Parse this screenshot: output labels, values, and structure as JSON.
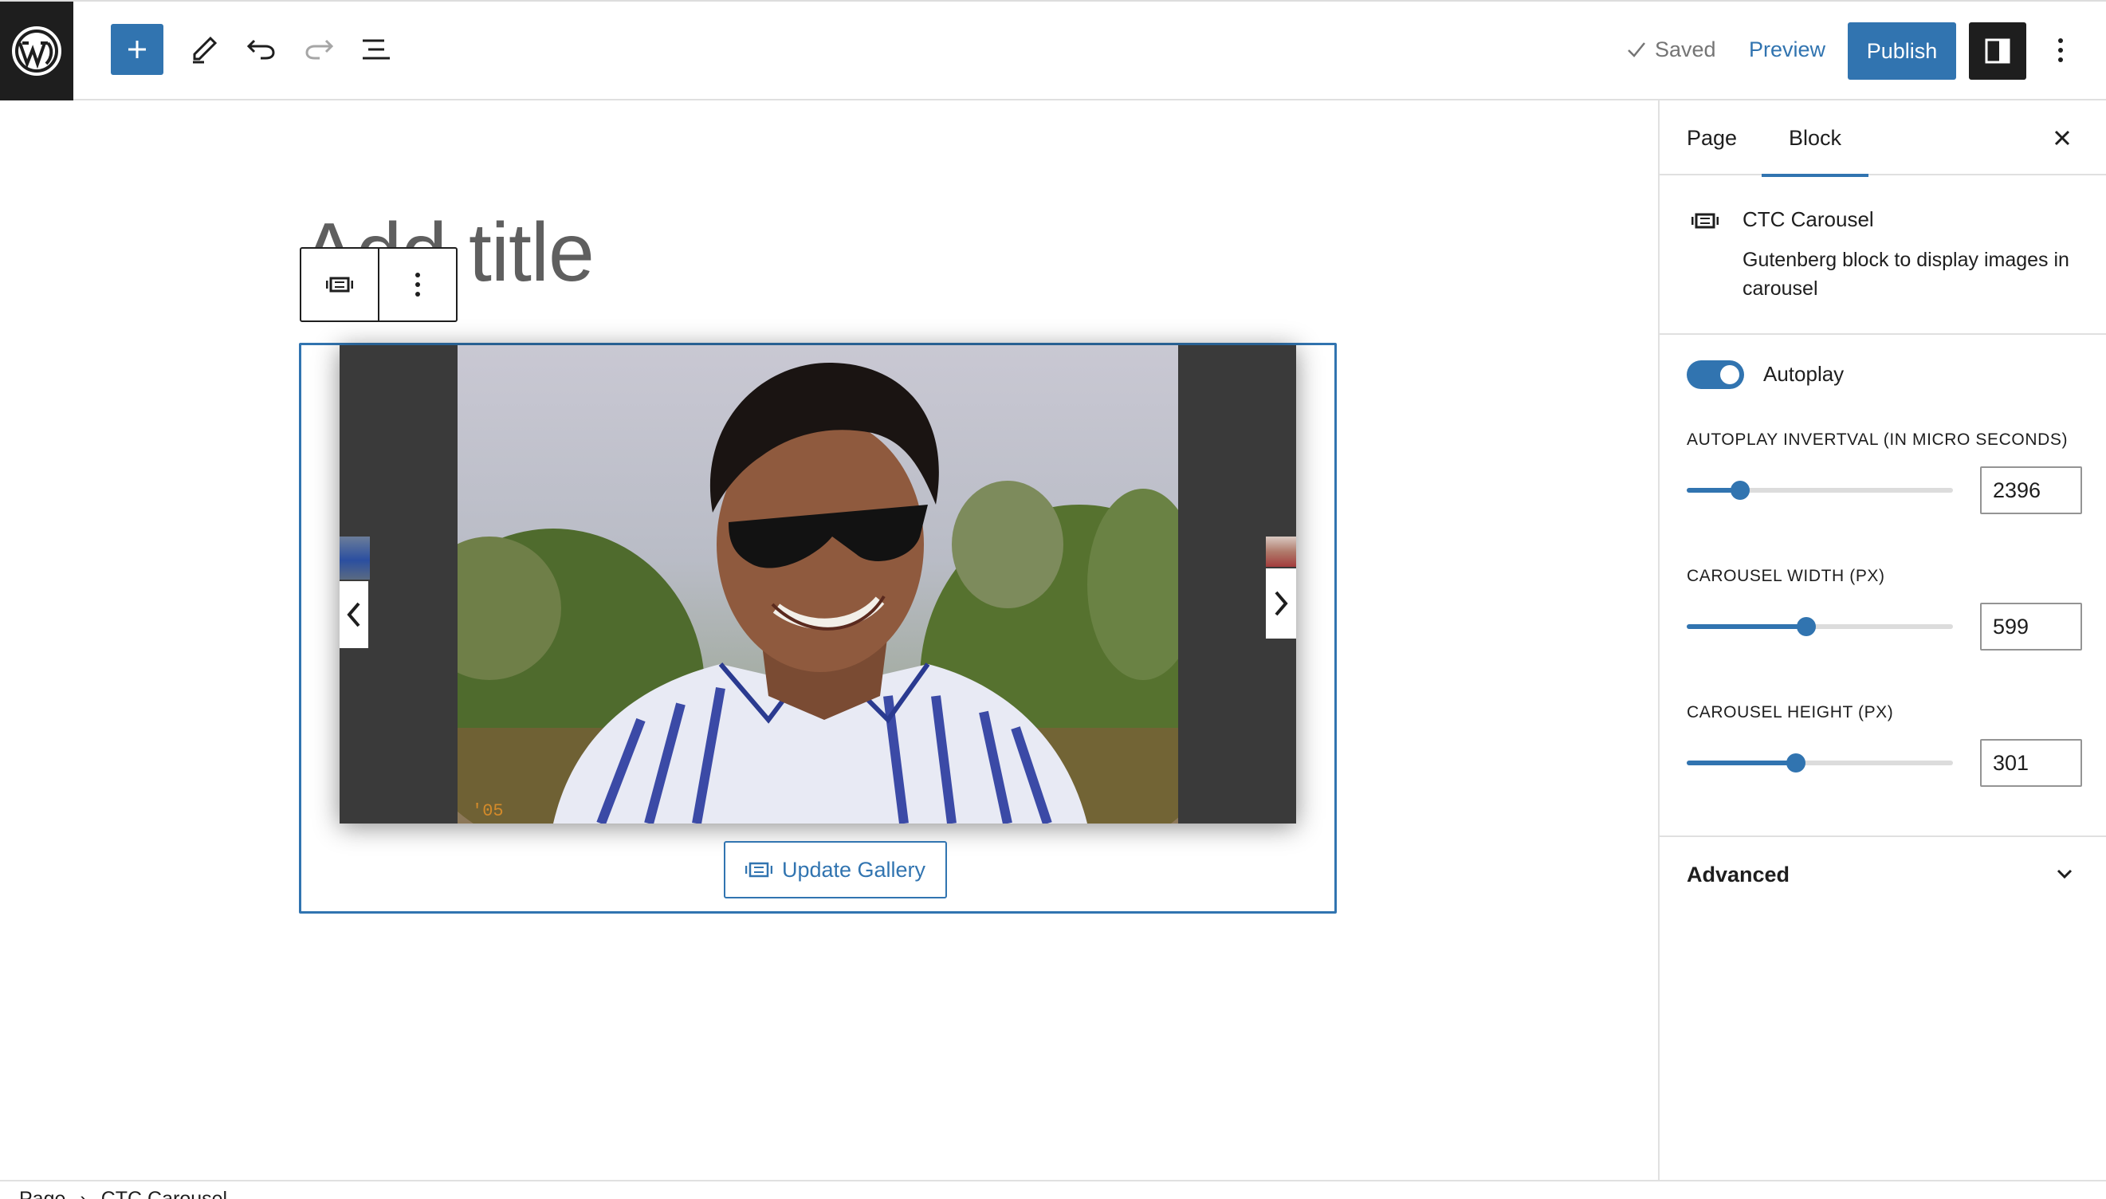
{
  "header": {
    "saved_label": "Saved",
    "preview_label": "Preview",
    "publish_label": "Publish"
  },
  "canvas": {
    "title_placeholder": "Add title",
    "update_gallery_label": "Update Gallery"
  },
  "sidebar": {
    "tabs": [
      {
        "label": "Page",
        "active": false
      },
      {
        "label": "Block",
        "active": true
      }
    ],
    "block": {
      "name": "CTC Carousel",
      "description": "Gutenberg block to display images in carousel"
    },
    "autoplay": {
      "label": "Autoplay",
      "enabled": true
    },
    "ranges": [
      {
        "label": "AUTOPLAY INVERTVAL (IN MICRO SECONDS)",
        "value": "2396",
        "fill_fraction": 0.2
      },
      {
        "label": "CAROUSEL WIDTH (PX)",
        "value": "599",
        "fill_fraction": 0.45
      },
      {
        "label": "CAROUSEL HEIGHT (PX)",
        "value": "301",
        "fill_fraction": 0.41
      }
    ],
    "advanced_label": "Advanced"
  },
  "footer": {
    "breadcrumb": [
      "Page",
      "CTC Carousel"
    ]
  },
  "colors": {
    "accent": "#3174b0",
    "dark": "#1e1e1e",
    "border": "#e0e0e0"
  }
}
